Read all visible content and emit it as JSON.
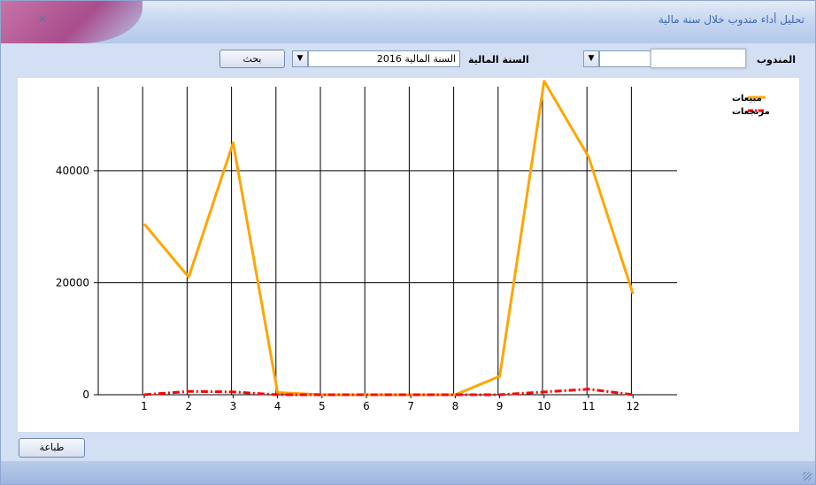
{
  "window": {
    "title": "تحليل أداء مندوب خلال سنة مالية"
  },
  "filters": {
    "rep_label": "المندوب",
    "rep_value": "",
    "year_label": "السنة المالية",
    "year_value": "السنة المالية 2016",
    "search_label": "بحث"
  },
  "footer": {
    "print_label": "طباعة"
  },
  "chart_data": {
    "type": "line",
    "x": [
      1,
      2,
      3,
      4,
      5,
      6,
      7,
      8,
      9,
      10,
      11,
      12
    ],
    "ylim": [
      0,
      55000
    ],
    "yticks": [
      0,
      20000,
      40000
    ],
    "grid": true,
    "legend_position": "top-right",
    "series": [
      {
        "name": "مبيعات",
        "color": "#ffa500",
        "style": "solid",
        "values": [
          30500,
          21000,
          45000,
          400,
          0,
          0,
          0,
          0,
          3300,
          56000,
          42500,
          18000
        ]
      },
      {
        "name": "مرتجعات",
        "color": "#ff0000",
        "style": "dash-dot",
        "values": [
          0,
          600,
          500,
          0,
          0,
          0,
          0,
          0,
          0,
          500,
          1000,
          0
        ]
      }
    ]
  }
}
